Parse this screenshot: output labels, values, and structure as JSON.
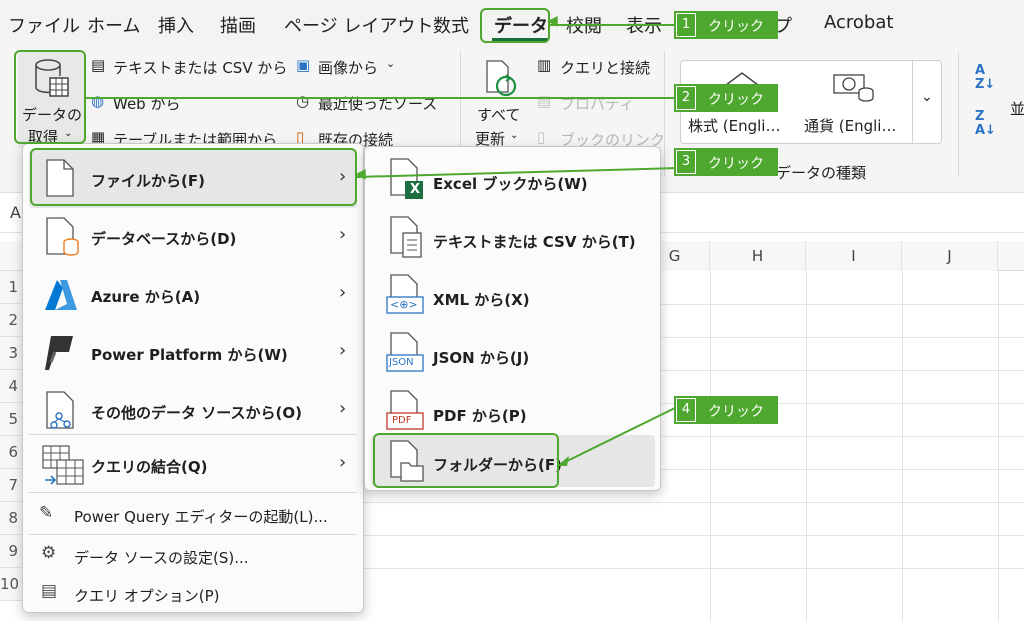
{
  "menu_tabs": [
    "ファイル",
    "ホーム",
    "挿入",
    "描画",
    "ページ レイアウト",
    "数式",
    "データ",
    "校閲",
    "表示",
    "ヘルプ",
    "Acrobat"
  ],
  "ribbon": {
    "get_data_line1": "データの",
    "get_data_line2": "取得",
    "text_csv": "テキストまたは CSV から",
    "from_web": "Web から",
    "from_table": "テーブルまたは範囲から",
    "from_image": "画像から",
    "recent_sources": "最近使ったソース",
    "existing_connections": "既存の接続",
    "refresh_all_line1": "すべて",
    "refresh_all_line2": "更新",
    "queries_connections": "クエリと接続",
    "properties": "プロパティ",
    "edit_links": "ブックのリンク",
    "stocks": "株式 (Engli…",
    "currencies": "通貨 (Engli…",
    "data_types_group": "データの種類",
    "sort_label": "並"
  },
  "name_box_partial": "A",
  "columns": [
    "G",
    "H",
    "I",
    "J"
  ],
  "rows": [
    "1",
    "2",
    "3",
    "4",
    "5",
    "6",
    "7",
    "8",
    "9",
    "10"
  ],
  "main_menu": {
    "items": [
      "ファイルから(F)",
      "データベースから(D)",
      "Azure から(A)",
      "Power Platform から(W)",
      "その他のデータ ソースから(O)",
      "クエリの結合(Q)"
    ],
    "plain_items": [
      "Power Query エディターの起動(L)...",
      "データ ソースの設定(S)...",
      "クエリ オプション(P)"
    ]
  },
  "sub_menu": {
    "items": [
      "Excel ブックから(W)",
      "テキストまたは CSV から(T)",
      "XML から(X)",
      "JSON から(J)",
      "PDF から(P)",
      "フォルダーから(F)"
    ],
    "icon_labels": {
      "xml": "<⊕>",
      "json": "JSON",
      "pdf": "PDF",
      "excel": "X"
    }
  },
  "callouts": [
    {
      "num": "1",
      "label": "クリック"
    },
    {
      "num": "2",
      "label": "クリック"
    },
    {
      "num": "3",
      "label": "クリック"
    },
    {
      "num": "4",
      "label": "クリック"
    }
  ],
  "colors": {
    "accent_green": "#4ea72e",
    "excel_green": "#1d6f42",
    "azure_blue": "#0078d4",
    "pdf_red": "#c0392b",
    "json_blue": "#2b74c5"
  }
}
